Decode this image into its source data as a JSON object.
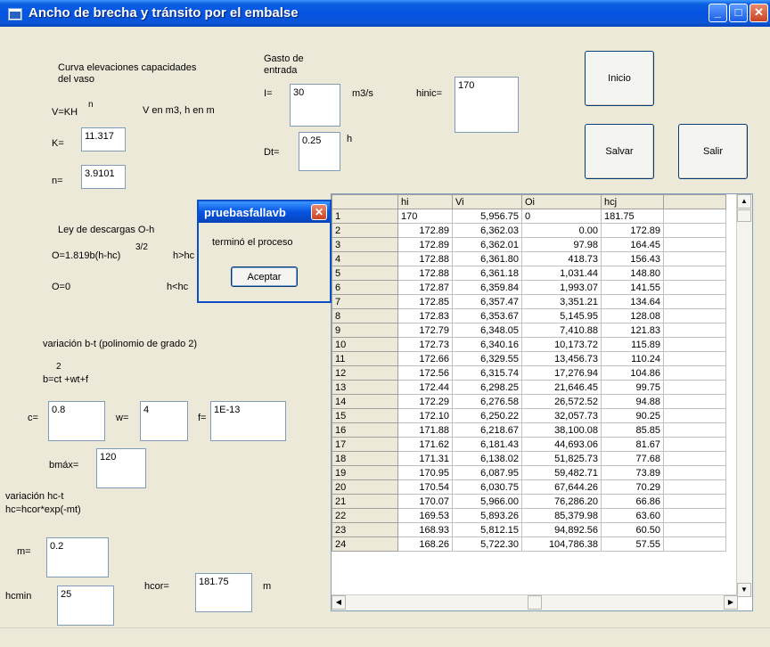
{
  "window": {
    "title": "Ancho de brecha y tránsito por el embalse",
    "minimize": "_",
    "maximize": "□",
    "close": "✕"
  },
  "curve": {
    "heading": "Curva elevaciones capacidades\ndel vaso",
    "formula": "V=KH",
    "exponent": "n",
    "units": "V en m3, h en m",
    "k_label": "K=",
    "k_value": "11.317",
    "n_label": "n=",
    "n_value": "3.9101"
  },
  "inflow": {
    "heading": "Gasto de\nentrada",
    "i_label": "I=",
    "i_value": "30",
    "i_units": "m3/s",
    "dt_label": "Dt=",
    "dt_value": "0.25",
    "dt_units": "h"
  },
  "hinic": {
    "label": "hinic=",
    "value": "170"
  },
  "buttons": {
    "inicio": "Inicio",
    "salvar": "Salvar",
    "salir": "Salir"
  },
  "discharge": {
    "heading": "Ley de descargas O-h",
    "formula": "O=1.819b(h-hc)",
    "exponent": "3/2",
    "condition": "h>hc",
    "zero_formula": "O=0",
    "zero_condition": "h<hc"
  },
  "bt": {
    "heading": "variación b-t (polinomio de grado 2)",
    "exponent": "2",
    "formula": "b=ct +wt+f",
    "c_label": "c=",
    "c_value": "0.8",
    "w_label": "w=",
    "w_value": "4",
    "f_label": "f=",
    "f_value": "1E-13",
    "bmax_label": "bmáx=",
    "bmax_value": "120"
  },
  "hc": {
    "heading": "variación hc-t",
    "formula": "hc=hcor*exp(-mt)",
    "m_label": "m=",
    "m_value": "0.2",
    "hcor_label": "hcor=",
    "hcor_value": "181.75",
    "hcor_units": "m",
    "hcmin_label": "hcmin",
    "hcmin_value": "25"
  },
  "grid": {
    "headers": [
      "",
      "hi",
      "Vi",
      "Oi",
      "hcj",
      ""
    ],
    "rows": [
      [
        "1",
        "170",
        "5,956.75",
        "0",
        "181.75"
      ],
      [
        "2",
        "172.89",
        "6,362.03",
        "0.00",
        "172.89"
      ],
      [
        "3",
        "172.89",
        "6,362.01",
        "97.98",
        "164.45"
      ],
      [
        "4",
        "172.88",
        "6,361.80",
        "418.73",
        "156.43"
      ],
      [
        "5",
        "172.88",
        "6,361.18",
        "1,031.44",
        "148.80"
      ],
      [
        "6",
        "172.87",
        "6,359.84",
        "1,993.07",
        "141.55"
      ],
      [
        "7",
        "172.85",
        "6,357.47",
        "3,351.21",
        "134.64"
      ],
      [
        "8",
        "172.83",
        "6,353.67",
        "5,145.95",
        "128.08"
      ],
      [
        "9",
        "172.79",
        "6,348.05",
        "7,410.88",
        "121.83"
      ],
      [
        "10",
        "172.73",
        "6,340.16",
        "10,173.72",
        "115.89"
      ],
      [
        "11",
        "172.66",
        "6,329.55",
        "13,456.73",
        "110.24"
      ],
      [
        "12",
        "172.56",
        "6,315.74",
        "17,276.94",
        "104.86"
      ],
      [
        "13",
        "172.44",
        "6,298.25",
        "21,646.45",
        "99.75"
      ],
      [
        "14",
        "172.29",
        "6,276.58",
        "26,572.52",
        "94.88"
      ],
      [
        "15",
        "172.10",
        "6,250.22",
        "32,057.73",
        "90.25"
      ],
      [
        "16",
        "171.88",
        "6,218.67",
        "38,100.08",
        "85.85"
      ],
      [
        "17",
        "171.62",
        "6,181.43",
        "44,693.06",
        "81.67"
      ],
      [
        "18",
        "171.31",
        "6,138.02",
        "51,825.73",
        "77.68"
      ],
      [
        "19",
        "170.95",
        "6,087.95",
        "59,482.71",
        "73.89"
      ],
      [
        "20",
        "170.54",
        "6,030.75",
        "67,644.26",
        "70.29"
      ],
      [
        "21",
        "170.07",
        "5,966.00",
        "76,286.20",
        "66.86"
      ],
      [
        "22",
        "169.53",
        "5,893.26",
        "85,379.98",
        "63.60"
      ],
      [
        "23",
        "168.93",
        "5,812.15",
        "94,892.56",
        "60.50"
      ],
      [
        "24",
        "168.26",
        "5,722.30",
        "104,786.38",
        "57.55"
      ]
    ]
  },
  "dialog": {
    "title": "pruebasfallavb",
    "message": "terminó el proceso",
    "ok": "Aceptar",
    "close": "✕"
  }
}
